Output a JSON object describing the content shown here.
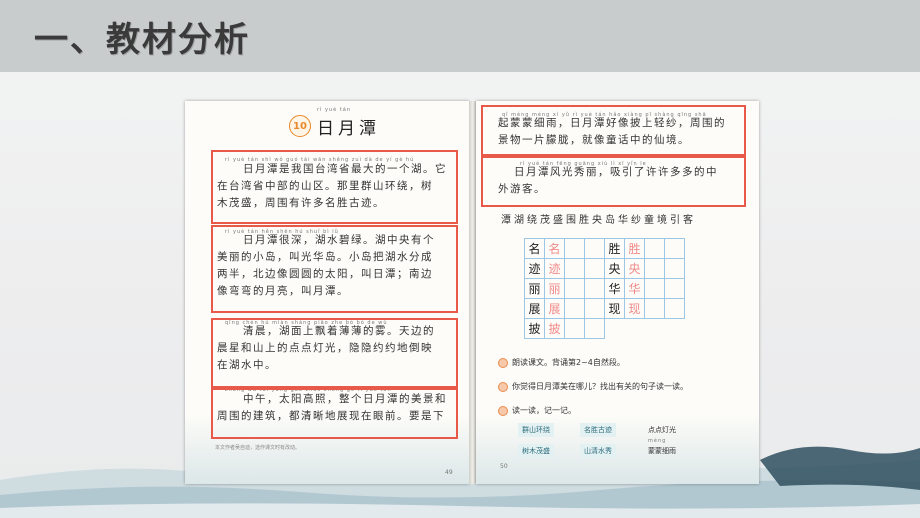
{
  "slide": {
    "title": "一、教材分析"
  },
  "book": {
    "lesson_number": "10",
    "lesson_title": "日月潭",
    "lesson_title_pinyin": "rì yuè tán",
    "paragraphs": [
      {
        "pinyin": "rì yuè tán shì wǒ guó tái wān shěng zuì dà de yí gè hú",
        "lines": [
          "日月潭是我国台湾省最大的一个湖。它",
          "在台湾省中部的山区。那里群山环绕，树",
          "木茂盛，周围有许多名胜古迹。"
        ]
      },
      {
        "pinyin": "rì yuè tán hěn shēn hú shuǐ bì lǜ",
        "lines": [
          "日月潭很深，湖水碧绿。湖中央有个",
          "美丽的小岛，叫光华岛。小岛把湖水分成",
          "两半，北边像圆圆的太阳，叫日潭；南边",
          "像弯弯的月亮，叫月潭。"
        ]
      },
      {
        "pinyin": "qīng chén hú miàn shàng piāo zhe bó bó de wù",
        "lines": [
          "清晨，湖面上飘着薄薄的雾。天边的",
          "晨星和山上的点点灯光，隐隐约约地倒映",
          "在湖水中。"
        ]
      },
      {
        "pinyin": "zhōng wǔ tài yáng gāo zhào zhěng gè rì yuè tán",
        "lines": [
          "中午，太阳高照，整个日月潭的美景和",
          "周围的建筑，都清晰地展现在眼前。要是下"
        ]
      }
    ],
    "right_paragraphs": [
      {
        "pinyin": "qǐ méng méng xì yǔ rì yuè tán hǎo xiàng pī shàng qīng shā",
        "lines": [
          "起蒙蒙细雨，日月潭好像披上轻纱，周围的",
          "景物一片朦胧，就像童话中的仙境。"
        ]
      },
      {
        "pinyin": "rì yuè tán fēng guāng xiù lì xī yǐn le",
        "lines": [
          "日月潭风光秀丽，吸引了许许多多的中",
          "外游客。"
        ]
      }
    ],
    "footnote": "本文作者吴自迪，选作课文时有改动。",
    "left_page_number": "49",
    "right_page_number": "50",
    "char_strip": "潭湖绕茂盛围胜央岛华纱童境引客",
    "writing_grid": [
      [
        "名",
        "名",
        "",
        "",
        "胜",
        "胜",
        "",
        ""
      ],
      [
        "迹",
        "迹",
        "",
        "",
        "央",
        "央",
        "",
        ""
      ],
      [
        "丽",
        "丽",
        "",
        "",
        "华",
        "华",
        "",
        ""
      ],
      [
        "展",
        "展",
        "",
        "",
        "现",
        "现",
        "",
        ""
      ],
      [
        "披",
        "披",
        "",
        "",
        "",
        "",
        "",
        ""
      ]
    ],
    "questions": [
      "朗读课文。背诵第2~4自然段。",
      "你觉得日月潭美在哪儿？找出有关的句子读一读。",
      "读一读，记一记。"
    ],
    "words": [
      "群山环绕",
      "名胜古迹",
      "点点灯光",
      "树木茂盛",
      "山清水秀",
      "蒙蒙细雨"
    ],
    "words_pinyin": "méng"
  },
  "colors": {
    "highlight": "#e8594a",
    "title": "#3a3a3a",
    "topbar": "#c9cccd"
  }
}
